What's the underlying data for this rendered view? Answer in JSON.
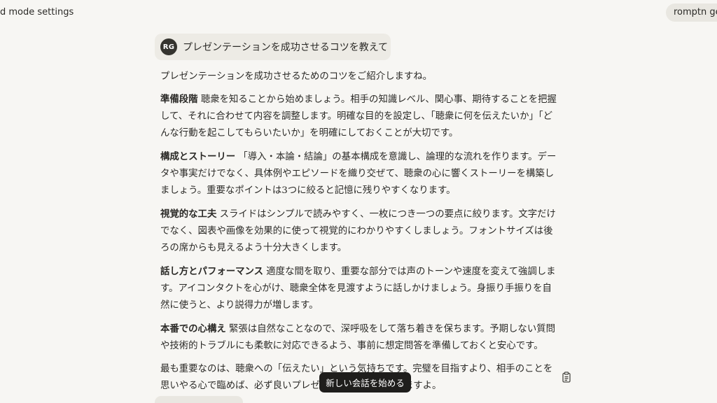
{
  "header": {
    "left_link": "d mode settings",
    "right_pill": "romptn gen"
  },
  "user_message": {
    "avatar_initials": "RG",
    "text": "プレゼンテーションを成功させるコツを教えて"
  },
  "response": {
    "intro": "プレゼンテーションを成功させるためのコツをご紹介しますね。",
    "sections": [
      {
        "title": "準備段階",
        "body": "聴衆を知ることから始めましょう。相手の知識レベル、関心事、期待することを把握して、それに合わせて内容を調整します。明確な目的を設定し、「聴衆に何を伝えたいか」「どんな行動を起こしてもらいたいか」を明確にしておくことが大切です。"
      },
      {
        "title": "構成とストーリー",
        "body": "「導入・本論・結論」の基本構成を意識し、論理的な流れを作ります。データや事実だけでなく、具体例やエピソードを織り交ぜて、聴衆の心に響くストーリーを構築しましょう。重要なポイントは3つに絞ると記憶に残りやすくなります。"
      },
      {
        "title": "視覚的な工夫",
        "body": "スライドはシンプルで読みやすく、一枚につき一つの要点に絞ります。文字だけでなく、図表や画像を効果的に使って視覚的にわかりやすくしましょう。フォントサイズは後ろの席からも見えるよう十分大きくします。"
      },
      {
        "title": "話し方とパフォーマンス",
        "body": "適度な間を取り、重要な部分では声のトーンや速度を変えて強調します。アイコンタクトを心がけ、聴衆全体を見渡すように話しかけましょう。身振り手振りを自然に使うと、より説得力が増します。"
      },
      {
        "title": "本番での心構え",
        "body": "緊張は自然なことなので、深呼吸をして落ち着きを保ちます。予期しない質問や技術的トラブルにも柔軟に対応できるよう、事前に想定問答を準備しておくと安心です。"
      }
    ],
    "closing": "最も重要なのは、聴衆への「伝えたい」という気持ちです。完璧を目指すより、相手のことを思いやる心で臨めば、必ず良いプレゼンテーションになりますよ。"
  },
  "actions": {
    "new_chat_label": "新しい会話を始める",
    "copy_icon": "clipboard-icon"
  }
}
